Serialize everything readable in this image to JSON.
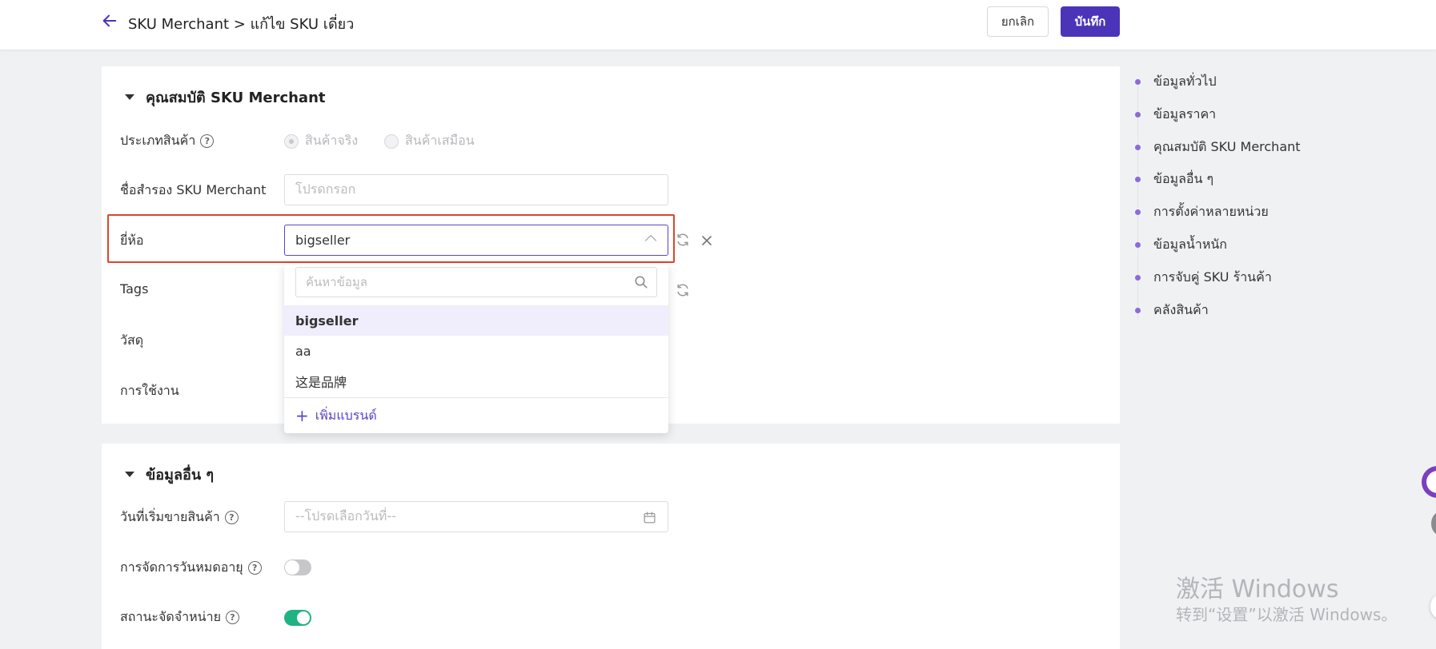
{
  "header": {
    "breadcrumb": "SKU Merchant > แก้ไข SKU เดี่ยว",
    "cancel_label": "ยกเลิก",
    "save_label": "บันทึก"
  },
  "section_sku": {
    "title": "คุณสมบัติ SKU Merchant",
    "product_type": {
      "label": "ประเภทสินค้า",
      "options": [
        "สินค้าจริง",
        "สินค้าเสมือน"
      ]
    },
    "alias": {
      "label": "ชื่อสำรอง SKU Merchant",
      "placeholder": "โปรดกรอก"
    },
    "brand": {
      "label": "ยี่ห้อ",
      "value": "bigseller"
    },
    "tags_label": "Tags",
    "material_label": "วัสดุ",
    "usage_label": "การใช้งาน"
  },
  "brand_dropdown": {
    "search_placeholder": "ค้นหาข้อมูล",
    "options": [
      "bigseller",
      "aa",
      "这是品牌"
    ],
    "add_label": "เพิ่มแบรนด์"
  },
  "section_other": {
    "title": "ข้อมูลอื่น ๆ",
    "sale_start": {
      "label": "วันที่เริ่มขายสินค้า",
      "placeholder": "--โปรดเลือกวันที่--"
    },
    "expiry_label": "การจัดการวันหมดอายุ",
    "expiry_enabled": false,
    "distribution_label": "สถานะจัดจำหน่าย",
    "distribution_enabled": true
  },
  "anchor_nav": [
    "ข้อมูลทั่วไป",
    "ข้อมูลราคา",
    "คุณสมบัติ SKU Merchant",
    "ข้อมูลอื่น ๆ",
    "การตั้งค่าหลายหน่วย",
    "ข้อมูลน้ำหนัก",
    "การจับคู่ SKU ร้านค้า",
    "คลังสินค้า"
  ],
  "watermark": {
    "line1": "激活 Windows",
    "line2": "转到“设置”以激活 Windows。"
  },
  "colors": {
    "primary": "#4b34b8",
    "accent": "#5a45c7",
    "highlight": "#d9472b",
    "toggle_on": "#1fb384",
    "nav_dot": "#8d6ad6"
  }
}
